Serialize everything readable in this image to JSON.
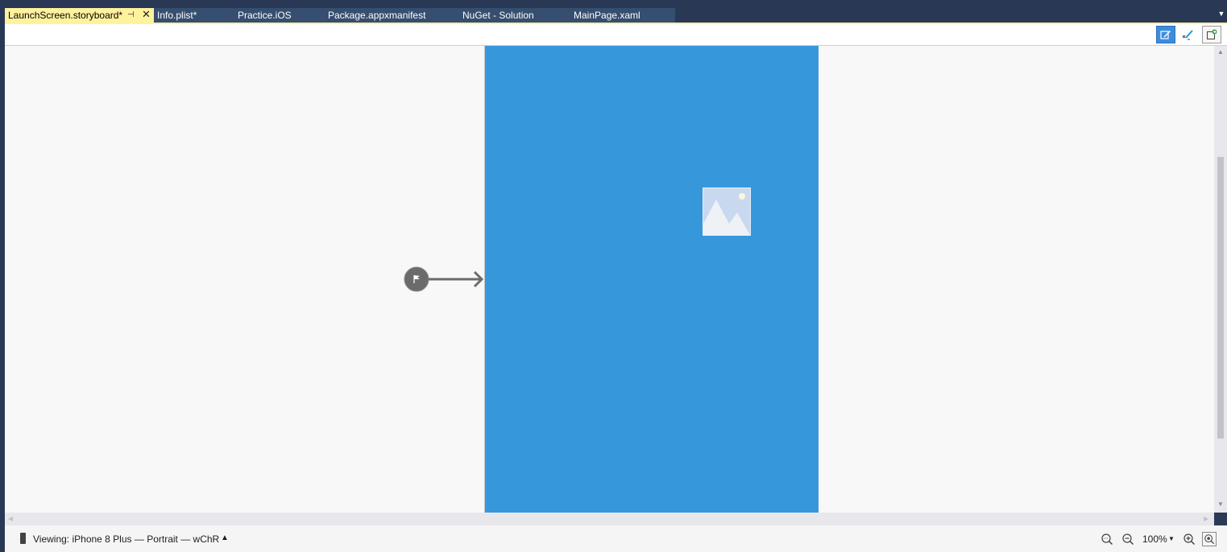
{
  "tabs": [
    {
      "label": "LaunchScreen.storyboard*",
      "active": true
    },
    {
      "label": "Info.plist*",
      "active": false
    },
    {
      "label": "Practice.iOS",
      "active": false
    },
    {
      "label": "Package.appxmanifest",
      "active": false
    },
    {
      "label": "NuGet - Solution",
      "active": false
    },
    {
      "label": "MainPage.xaml",
      "active": false
    }
  ],
  "toolbar": {
    "icons": [
      "edit-mode-icon",
      "constraints-icon",
      "export-icon"
    ]
  },
  "canvas": {
    "scene_color": "#3797db",
    "icons": [
      "image-placeholder-icon",
      "initial-view-controller-arrow-icon"
    ]
  },
  "status": {
    "viewing": "Viewing: iPhone 8 Plus — Portrait — wChR",
    "zoom": "100%"
  },
  "colors": {
    "tab_active": "#fff29d",
    "tab_strip": "#293955",
    "accent": "#3c8cde"
  }
}
